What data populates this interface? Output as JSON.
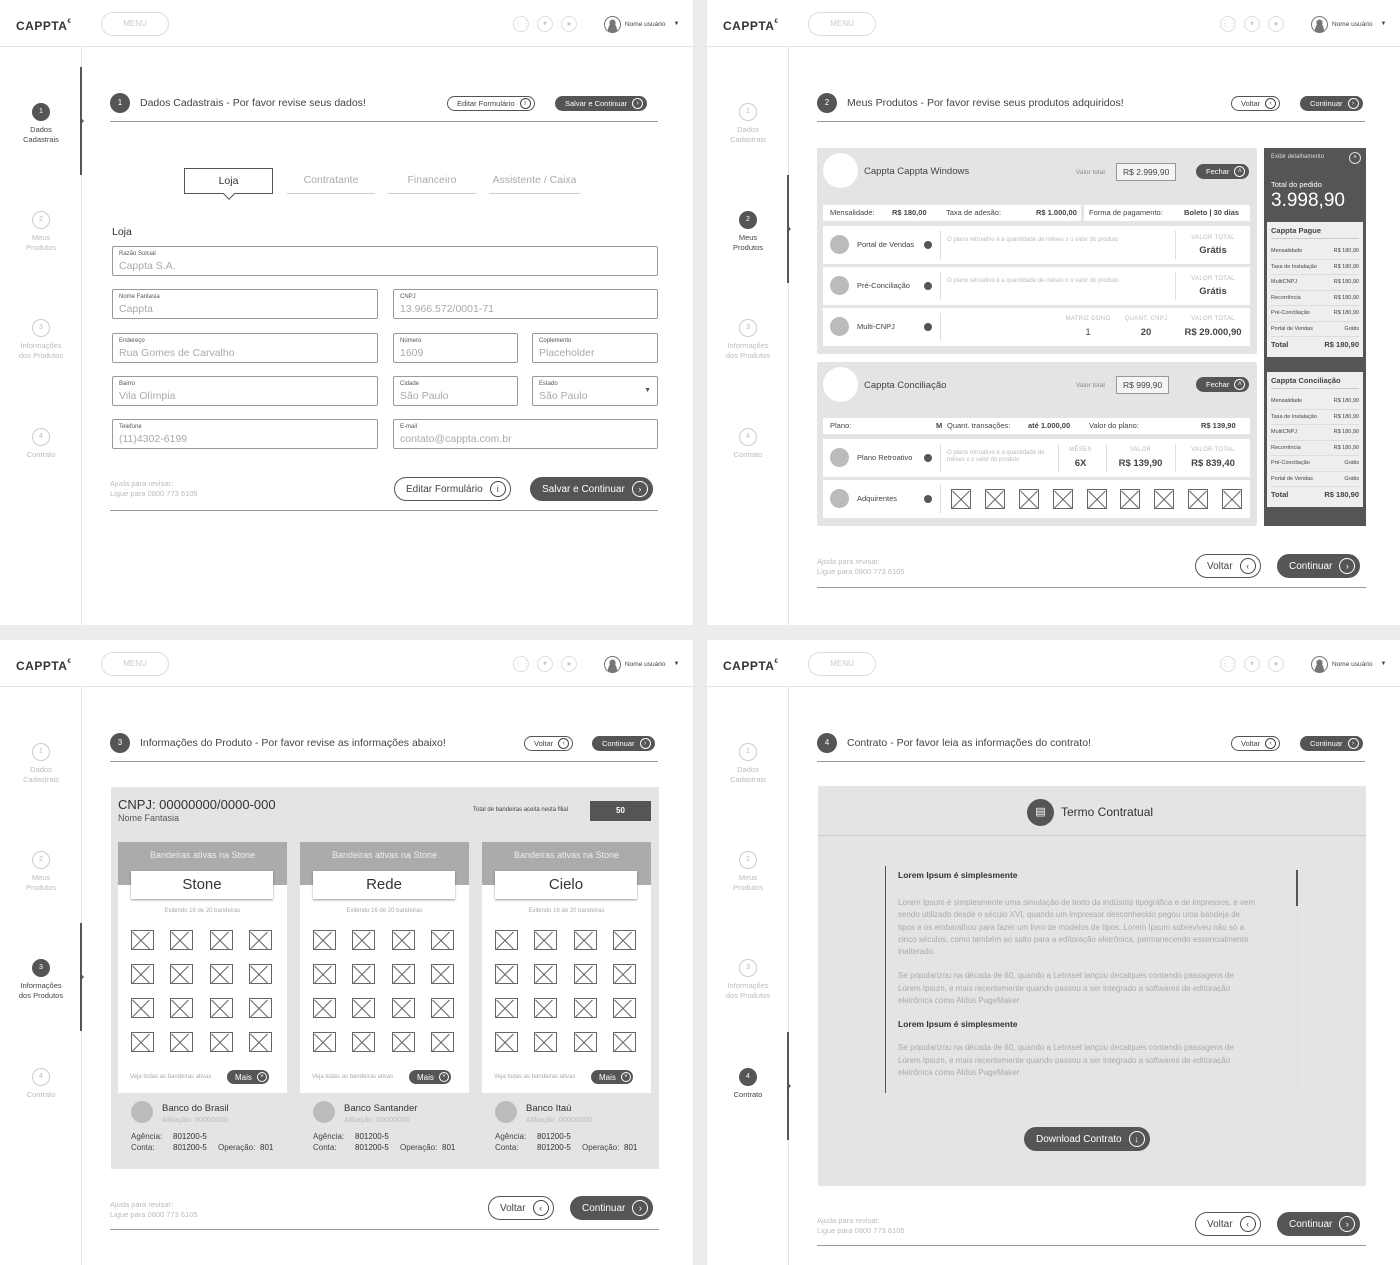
{
  "common": {
    "logo": "CAPPTA",
    "menu": "MENU",
    "user": "Nome usuário",
    "help_title": "Ajuda para revisar:",
    "help_phone": "Ligue para 0800 773 6105",
    "steps": [
      {
        "num": "1",
        "label_1": "Dados",
        "label_2": "Cadastrais"
      },
      {
        "num": "2",
        "label_1": "Meus",
        "label_2": "Produtos"
      },
      {
        "num": "3",
        "label_1": "Informações",
        "label_2": "dos Produtos"
      },
      {
        "num": "4",
        "label_1": "Contrato",
        "label_2": ""
      }
    ],
    "voltar": "Voltar",
    "continuar": "Continuar"
  },
  "s1": {
    "num": "1",
    "title": "Dados Cadastrais - Por favor revise seus dados!",
    "edit": "Editar Formulário",
    "save": "Salvar e Continuar",
    "tabs": [
      "Loja",
      "Contratante",
      "Financeiro",
      "Assistente / Caixa"
    ],
    "section": "Loja",
    "fields": {
      "razao": {
        "label": "Razão Solcial",
        "value": "Cappta S.A."
      },
      "fantasia": {
        "label": "Nome Fantasia",
        "value": "Cappta"
      },
      "cnpj": {
        "label": "CNPJ",
        "value": "13.966.572/0001-71"
      },
      "endereco": {
        "label": "Endereço",
        "value": "Rua Gomes de Carvalho"
      },
      "numero": {
        "label": "Número",
        "value": "1609"
      },
      "complemento": {
        "label": "Coplemento",
        "value": "Placeholder"
      },
      "bairro": {
        "label": "Bairro",
        "value": "Vila Olímpia"
      },
      "cidade": {
        "label": "Cidade",
        "value": "São Paulo"
      },
      "estado": {
        "label": "Estado",
        "value": "São Paulo"
      },
      "telefone": {
        "label": "Telefone",
        "value": "(11)4302-6199"
      },
      "email": {
        "label": "E-mail",
        "value": "contato@cappta.com.br"
      }
    }
  },
  "s2": {
    "num": "2",
    "title": "Meus Produtos - Por favor revise seus produtos adquiridos!",
    "valor_total": "Valor total",
    "fechar": "Fechar",
    "p1": {
      "name": "Cappta Cappta Windows",
      "price": "R$ 2.999,90",
      "mens_label": "Mensalidade:",
      "mens_val": "R$ 180,00",
      "tx_label": "Taxa de adesão:",
      "tx_val": "R$ 1.000,00",
      "fp_label": "Forma de pagamento:",
      "fp_val": "Boleto | 30 dias",
      "rows": [
        {
          "name": "Portal de Vendas",
          "desc": "O plano retroativo é a quantidade de mêses x o valor do produto",
          "vlabel": "VALOR TOTAL",
          "value": "Grátis"
        },
        {
          "name": "Pré-Conciliação",
          "desc": "O plano retroativo é a quantidade de mêses x o valor do produto",
          "vlabel": "VALOR TOTAL",
          "value": "Grátis"
        }
      ],
      "multi": {
        "name": "Multi-CNPJ",
        "l1": "MATRIZ DONO",
        "v1": "1",
        "l2": "QUANT. CNPJ",
        "v2": "20",
        "l3": "VALOR TOTAL",
        "v3": "R$ 29.000,90"
      }
    },
    "p2": {
      "name": "Cappta Conciliação",
      "price": "R$ 999,90",
      "plano_label": "Plano:",
      "plano_val": "M",
      "qt_label": "Quant. transações:",
      "qt_val": "até 1.000,00",
      "vp_label": "Valor do plano:",
      "vp_val": "R$ 139,90",
      "retro": {
        "name": "Plano Retroativo",
        "desc": "O plano retroativo é a quantidade de mêses x o valor do produto",
        "l1": "MÊSES",
        "v1": "6X",
        "l2": "VALOR",
        "v2": "R$ 139,90",
        "l3": "VALOR TOTAL",
        "v3": "R$ 839,40"
      },
      "adq": {
        "name": "Adquirentes"
      }
    },
    "summary": {
      "toggle": "Exibir detalhamento",
      "total_label": "Total do pedido",
      "total": "3.998,90",
      "cards": [
        {
          "title": "Cappta Pague",
          "rows": [
            [
              "Mensalidade",
              "R$ 180,90"
            ],
            [
              "Taxa de Instalação",
              "R$ 180,90"
            ],
            [
              "MultiCNPJ",
              "R$ 180,90"
            ],
            [
              "Recorrência",
              "R$ 180,90"
            ],
            [
              "Pré-Conciliação",
              "R$ 180,90"
            ],
            [
              "Portal de Vendas",
              "Grátis"
            ]
          ],
          "total_label": "Total",
          "total": "R$ 180,90"
        },
        {
          "title": "Cappta Conciliação",
          "rows": [
            [
              "Mensalidade",
              "R$ 180,90"
            ],
            [
              "Taxa de Instalação",
              "R$ 180,90"
            ],
            [
              "MultiCNPJ",
              "R$ 180,90"
            ],
            [
              "Recorrência",
              "R$ 180,90"
            ],
            [
              "Pré-Conciliação",
              "Grátis"
            ],
            [
              "Portal de Vendas",
              "Grátis"
            ]
          ],
          "total_label": "Total",
          "total": "R$ 180,90"
        }
      ]
    }
  },
  "s3": {
    "num": "3",
    "title": "Informações do Produto - Por favor revise as informações abaixo!",
    "cnpj": "CNPJ: 00000000/0000-000",
    "nome_fantasia": "Nome Fantasia",
    "total_flags_label": "Total de bandeiras aceita nesta filial",
    "total_flags": "50",
    "cards": [
      {
        "header": "Bandeiras ativas na Stone",
        "name": "Stone",
        "exibindo": "Exibindo 16 de 20 bandeiras",
        "ver": "Veja todas as bandeiras ativas",
        "mais": "Mais",
        "bank": "Banco do Brasil",
        "afil": "Afiliação: 00000000",
        "ag_label": "Agência:",
        "ag": "801200-5",
        "conta_label": "Conta:",
        "conta": "801200-5",
        "op_label": "Operação:",
        "op": "801"
      },
      {
        "header": "Bandeiras ativas na Stone",
        "name": "Rede",
        "exibindo": "Exibindo 16 de 20 bandeiras",
        "ver": "Veja todas as bandeiras ativas",
        "mais": "Mais",
        "bank": "Banco Santander",
        "afil": "Afiliação: 00000000",
        "ag_label": "Agência:",
        "ag": "801200-5",
        "conta_label": "Conta:",
        "conta": "801200-5",
        "op_label": "Operação:",
        "op": "801"
      },
      {
        "header": "Bandeiras ativas na Stone",
        "name": "Cielo",
        "exibindo": "Exibindo 16 de 20 bandeiras",
        "ver": "Veja todas as bandeiras ativas",
        "mais": "Mais",
        "bank": "Banco Itaú",
        "afil": "Afiliação: 00000000",
        "ag_label": "Agência:",
        "ag": "801200-5",
        "conta_label": "Conta:",
        "conta": "801200-5",
        "op_label": "Operação:",
        "op": "801"
      }
    ]
  },
  "s4": {
    "num": "4",
    "title": "Contrato - Por favor leia as informações do contrato!",
    "doc_title": "Termo Contratual",
    "h1": "Lorem Ipsum é simplesmente",
    "p1": "Lorem Ipsum é simplesmente uma simulação de texto da indústria tipográfica e de impressos, e vem sendo utilizado desde o século XVI, quando um impressor desconhecido pegou uma bandeja de tipos e os embaralhou para fazer um livro de modelos de tipos. Lorem Ipsum sobreviveu não só a cinco séculos, como também ao salto para a editoração eletrônica, permanecendo essencialmente inalterado.",
    "p2": "Se popularizou na década de 60, quando a Letraset lançou decalques contendo passagens de Lorem Ipsum, e mais recentemente quando passou a ser integrado a softwares de editoração eletrônica como Aldus PageMaker.",
    "h2": "Lorem Ipsum é simplesmente",
    "p3": "Se popularizou na década de 60, quando a Letraset lançou decalques contendo passagens de Lorem Ipsum, e mais recentemente quando passou a ser integrado a softwares de editoração eletrônica como Aldus PageMaker.",
    "download": "Download Contrato"
  }
}
